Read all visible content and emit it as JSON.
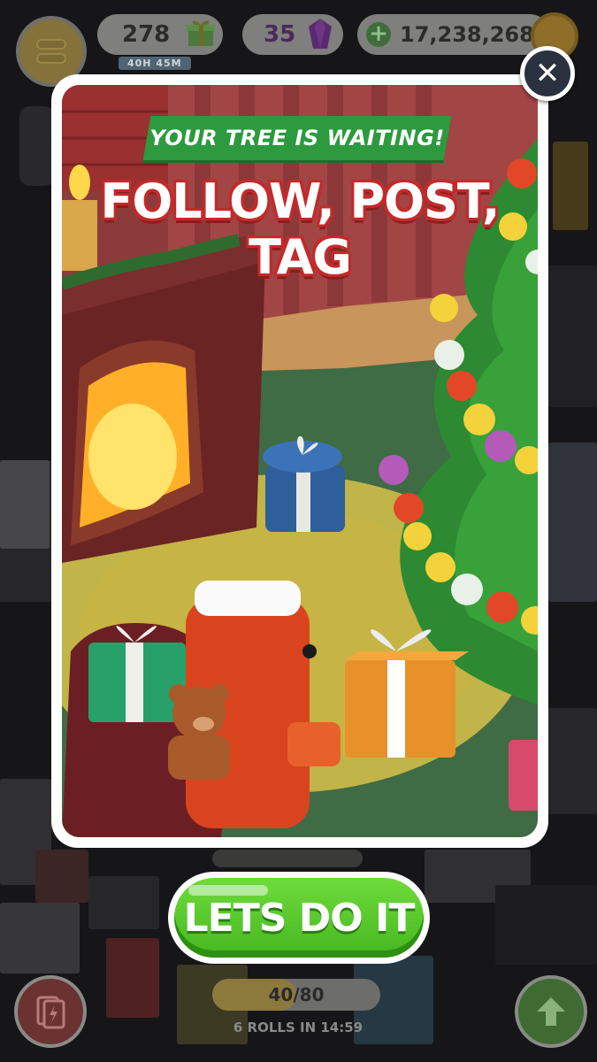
{
  "hud": {
    "gifts_count": "278",
    "gifts_timer": "40H 45M",
    "gems_count": "35",
    "coins_amount": "17,238,268",
    "plus_symbol": "+",
    "coin_icon": "coin-icon",
    "menu_icon": "menu-icon"
  },
  "modal": {
    "banner": "YOUR TREE IS WAITING!",
    "headline": "FOLLOW, POST, TAG",
    "close_symbol": "✕",
    "cta_label": "LETS DO IT"
  },
  "bottom": {
    "rolls_progress": "40/80",
    "rolls_fraction": 0.5,
    "rolls_timer": "6 ROLLS IN 14:59"
  },
  "colors": {
    "banner_green": "#2d9a3f",
    "headline_red": "#c32a2a",
    "cta_green": "#45b720",
    "modal_border": "#ffffff"
  }
}
